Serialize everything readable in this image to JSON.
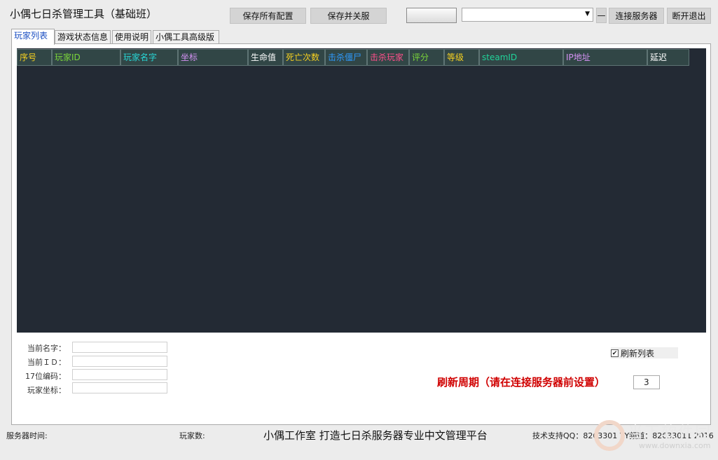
{
  "window": {
    "title": "小偶七日杀管理工具（基础班）"
  },
  "toolbar": {
    "save_all_label": "保存所有配置",
    "save_shutdown_label": "保存并关服",
    "server_select_value": "",
    "minus_label": "—",
    "connect_label": "连接服务器",
    "disconnect_label": "断开退出"
  },
  "tabs": [
    {
      "label": "玩家列表",
      "active": true
    },
    {
      "label": "游戏状态信息",
      "active": false
    },
    {
      "label": "使用说明",
      "active": false
    },
    {
      "label": "小偶工具高级版",
      "active": false
    }
  ],
  "table": {
    "columns": [
      {
        "label": "序号",
        "color": "#f5d020"
      },
      {
        "label": "玩家ID",
        "color": "#7bd63a"
      },
      {
        "label": "玩家名字",
        "color": "#27d8d8"
      },
      {
        "label": "坐标",
        "color": "#d592f4"
      },
      {
        "label": "生命值",
        "color": "#ffffff"
      },
      {
        "label": "死亡次数",
        "color": "#f5d020"
      },
      {
        "label": "击杀僵尸",
        "color": "#2e9bff"
      },
      {
        "label": "击杀玩家",
        "color": "#ff4f8b"
      },
      {
        "label": "评分",
        "color": "#7bd63a"
      },
      {
        "label": "等级",
        "color": "#f5d020"
      },
      {
        "label": "steamID",
        "color": "#21d39a"
      },
      {
        "label": "IP地址",
        "color": "#d592f4"
      },
      {
        "label": "延迟",
        "color": "#ffffff"
      }
    ],
    "rows": []
  },
  "detail_fields": [
    {
      "label": "当前名字：",
      "value": ""
    },
    {
      "label": "当前ＩＤ：",
      "value": ""
    },
    {
      "label": "17位编码：",
      "value": ""
    },
    {
      "label": "玩家坐标：",
      "value": ""
    }
  ],
  "refresh": {
    "checkbox_label": "刷新列表",
    "checked": true,
    "period_label": "刷新周期（请在连接服务器前设置）",
    "period_value": "3"
  },
  "statusbar": {
    "server_time_label": "服务器时间:",
    "player_count_label": "玩家数:",
    "slogan": "小偶工作室 打造七日杀服务器专业中文管理平台",
    "support": "技术支持QQ：8263301 YY频道：82633011 2016"
  },
  "watermark": {
    "text": "当下软件园",
    "url": "www.downxia.com"
  }
}
